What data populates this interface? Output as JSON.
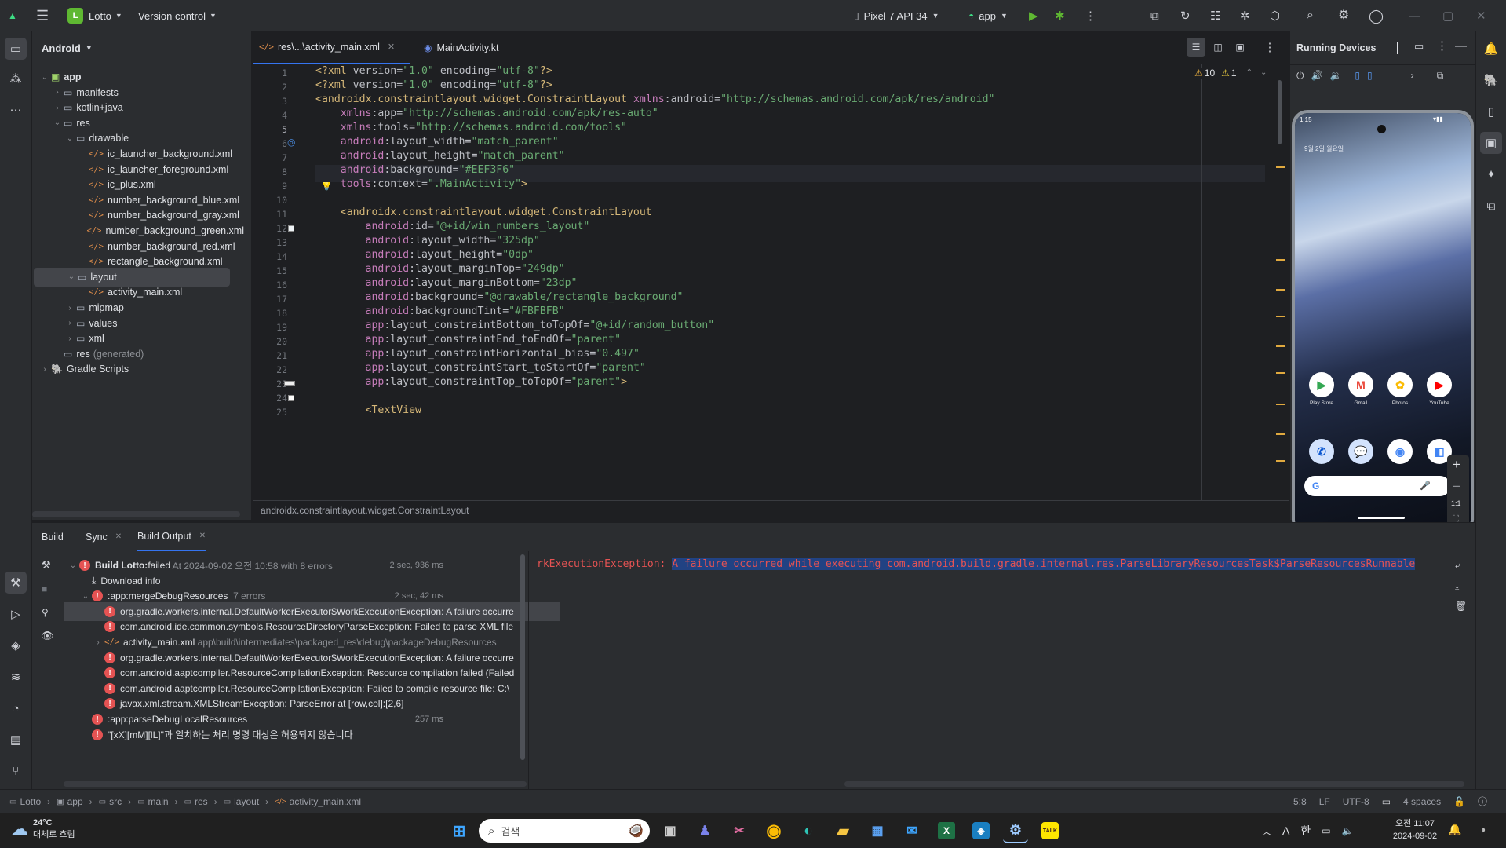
{
  "titlebar": {
    "project_initial": "L",
    "project": "Lotto",
    "vcs": "Version control",
    "device": "Pixel 7 API 34",
    "run_config": "app"
  },
  "project_panel": {
    "view": "Android",
    "tree": [
      {
        "label": "app",
        "depth": 0,
        "expanded": true,
        "type": "module"
      },
      {
        "label": "manifests",
        "depth": 1,
        "expanded": false,
        "type": "folder"
      },
      {
        "label": "kotlin+java",
        "depth": 1,
        "expanded": false,
        "type": "folder"
      },
      {
        "label": "res",
        "depth": 1,
        "expanded": true,
        "type": "folder"
      },
      {
        "label": "drawable",
        "depth": 2,
        "expanded": true,
        "type": "folder"
      },
      {
        "label": "ic_launcher_background.xml",
        "depth": 3,
        "type": "xml"
      },
      {
        "label": "ic_launcher_foreground.xml",
        "depth": 3,
        "type": "xml"
      },
      {
        "label": "ic_plus.xml",
        "depth": 3,
        "type": "xml"
      },
      {
        "label": "number_background_blue.xml",
        "depth": 3,
        "type": "xml"
      },
      {
        "label": "number_background_gray.xml",
        "depth": 3,
        "type": "xml"
      },
      {
        "label": "number_background_green.xml",
        "depth": 3,
        "type": "xml"
      },
      {
        "label": "number_background_red.xml",
        "depth": 3,
        "type": "xml"
      },
      {
        "label": "rectangle_background.xml",
        "depth": 3,
        "type": "xml"
      },
      {
        "label": "layout",
        "depth": 2,
        "expanded": true,
        "type": "folder",
        "selected": true
      },
      {
        "label": "activity_main.xml",
        "depth": 3,
        "type": "xml"
      },
      {
        "label": "mipmap",
        "depth": 2,
        "expanded": false,
        "type": "folder"
      },
      {
        "label": "values",
        "depth": 2,
        "expanded": false,
        "type": "folder"
      },
      {
        "label": "xml",
        "depth": 2,
        "expanded": false,
        "type": "folder"
      },
      {
        "label": "res",
        "suffix": "(generated)",
        "depth": 1,
        "type": "folder-gen"
      },
      {
        "label": "Gradle Scripts",
        "depth": 0,
        "expanded": false,
        "type": "gradle"
      }
    ]
  },
  "editor": {
    "tabs": [
      {
        "label": "res\\...\\activity_main.xml",
        "active": true
      },
      {
        "label": "MainActivity.kt",
        "active": false
      }
    ],
    "warnings": "10",
    "weak_warnings": "1",
    "breadcrumb": "androidx.constraintlayout.widget.ConstraintLayout",
    "lines": [
      {
        "n": "1",
        "text": "<?xml version=\"1.0\" encoding=\"utf-8\"?>"
      },
      {
        "n": "2",
        "text": "<?xml version=\"1.0\" encoding=\"utf-8\"?>"
      },
      {
        "n": "3",
        "text": "<androidx.constraintlayout.widget.ConstraintLayout xmlns:android=\"http://schemas.android.com/apk/res/android\""
      },
      {
        "n": "4",
        "text": "    xmlns:app=\"http://schemas.android.com/apk/res-auto\""
      },
      {
        "n": "5",
        "text": "    xmlns:tools=\"http://schemas.android.com/tools\""
      },
      {
        "n": "6",
        "text": "    android:layout_width=\"match_parent\""
      },
      {
        "n": "7",
        "text": "    android:layout_height=\"match_parent\""
      },
      {
        "n": "8",
        "text": "    android:background=\"#EEF3F6\""
      },
      {
        "n": "9",
        "text": "    tools:context=\".MainActivity\">"
      },
      {
        "n": "10",
        "text": ""
      },
      {
        "n": "11",
        "text": "    <androidx.constraintlayout.widget.ConstraintLayout"
      },
      {
        "n": "12",
        "text": "        android:id=\"@+id/win_numbers_layout\""
      },
      {
        "n": "13",
        "text": "        android:layout_width=\"325dp\""
      },
      {
        "n": "14",
        "text": "        android:layout_height=\"0dp\""
      },
      {
        "n": "15",
        "text": "        android:layout_marginTop=\"249dp\""
      },
      {
        "n": "16",
        "text": "        android:layout_marginBottom=\"23dp\""
      },
      {
        "n": "17",
        "text": "        android:background=\"@drawable/rectangle_background\""
      },
      {
        "n": "18",
        "text": "        android:backgroundTint=\"#FBFBFB\""
      },
      {
        "n": "19",
        "text": "        app:layout_constraintBottom_toTopOf=\"@+id/random_button\""
      },
      {
        "n": "20",
        "text": "        app:layout_constraintEnd_toEndOf=\"parent\""
      },
      {
        "n": "21",
        "text": "        app:layout_constraintHorizontal_bias=\"0.497\""
      },
      {
        "n": "22",
        "text": "        app:layout_constraintStart_toStartOf=\"parent\""
      },
      {
        "n": "23",
        "text": "        app:layout_constraintTop_toTopOf=\"parent\">"
      },
      {
        "n": "24",
        "text": ""
      },
      {
        "n": "25",
        "text": "        <TextView"
      }
    ]
  },
  "devices": {
    "title": "Running Devices",
    "status_time": "1:15",
    "date_text": "9월 2일 월요일",
    "apps_row1": [
      {
        "label": "Play Store",
        "bg": "#ffffff",
        "glyph": "▶",
        "fg": "#34a853"
      },
      {
        "label": "Gmail",
        "bg": "#ffffff",
        "glyph": "M",
        "fg": "#ea4335"
      },
      {
        "label": "Photos",
        "bg": "#ffffff",
        "glyph": "✿",
        "fg": "#fbbc05"
      },
      {
        "label": "YouTube",
        "bg": "#ffffff",
        "glyph": "▶",
        "fg": "#ff0000"
      }
    ],
    "apps_row2": [
      {
        "bg": "#d3e3fd",
        "glyph": "✆",
        "fg": "#0b57d0"
      },
      {
        "bg": "#d3e3fd",
        "glyph": "💬",
        "fg": "#0b57d0"
      },
      {
        "bg": "#ffffff",
        "glyph": "◉",
        "fg": "#4285f4"
      },
      {
        "bg": "#ffffff",
        "glyph": "◧",
        "fg": "#4285f4"
      }
    ],
    "zoom_label": "1:1",
    "search_logo": "G"
  },
  "build": {
    "tabs": [
      {
        "label": "Build",
        "active": false
      },
      {
        "label": "Sync",
        "active": false,
        "closable": true
      },
      {
        "label": "Build Output",
        "active": true,
        "closable": true
      }
    ],
    "tree": [
      {
        "indent": 0,
        "chev": "⌄",
        "icon": "err",
        "bold": "Build Lotto:",
        "text": " failed",
        "muted": " At 2024-09-02 오전 10:58 with 8 errors",
        "time": "2 sec, 936 ms"
      },
      {
        "indent": 1,
        "chev": "",
        "icon": "download",
        "text": "Download info"
      },
      {
        "indent": 1,
        "chev": "⌄",
        "icon": "err",
        "text": ":app:mergeDebugResources",
        "muted": "  7 errors",
        "time": "2 sec, 42 ms"
      },
      {
        "indent": 2,
        "chev": "",
        "icon": "err",
        "text": "org.gradle.workers.internal.DefaultWorkerExecutor$WorkExecutionException: A failure occurre",
        "selected": true
      },
      {
        "indent": 2,
        "chev": "",
        "icon": "err",
        "text": "com.android.ide.common.symbols.ResourceDirectoryParseException: Failed to parse XML file"
      },
      {
        "indent": 2,
        "chev": "›",
        "icon": "xml",
        "text": "activity_main.xml",
        "muted": " app\\build\\intermediates\\packaged_res\\debug\\packageDebugResources"
      },
      {
        "indent": 2,
        "chev": "",
        "icon": "err",
        "text": "org.gradle.workers.internal.DefaultWorkerExecutor$WorkExecutionException: A failure occurre"
      },
      {
        "indent": 2,
        "chev": "",
        "icon": "err",
        "text": "com.android.aaptcompiler.ResourceCompilationException: Resource compilation failed (Failed"
      },
      {
        "indent": 2,
        "chev": "",
        "icon": "err",
        "text": "com.android.aaptcompiler.ResourceCompilationException: Failed to compile resource file: C:\\"
      },
      {
        "indent": 2,
        "chev": "",
        "icon": "err",
        "text": "javax.xml.stream.XMLStreamException: ParseError at [row,col]:[2,6]"
      },
      {
        "indent": 1,
        "chev": "",
        "icon": "err",
        "text": ":app:parseDebugLocalResources",
        "time": "257 ms"
      },
      {
        "indent": 1,
        "chev": "",
        "icon": "err",
        "text": "\"[xX][mM][lL]\"과 일치하는 처리 명령 대상은 허용되지 않습니다"
      }
    ],
    "console_prefix": "rkExecutionException:",
    "console_selected": "A failure occurred while executing com.android.build.gradle.internal.res.ParseLibraryResourcesTask$ParseResourcesRunnable"
  },
  "statusbar": {
    "path": [
      "Lotto",
      "app",
      "src",
      "main",
      "res",
      "layout",
      "activity_main.xml"
    ],
    "position": "5:8",
    "line_sep": "LF",
    "encoding": "UTF-8",
    "indent": "4 spaces"
  },
  "taskbar": {
    "weather_temp": "24°C",
    "weather_desc": "대체로 흐림",
    "search_placeholder": "검색",
    "ime_lang": "A",
    "ime_mode": "한",
    "time": "오전 11:07",
    "date": "2024-09-02"
  },
  "colors": {
    "accent": "#3574f0",
    "error": "#e55353",
    "warning": "#e0a93f",
    "xml_tag": "#d5b778",
    "xml_ns": "#c77dbb",
    "xml_string": "#6aab73"
  }
}
